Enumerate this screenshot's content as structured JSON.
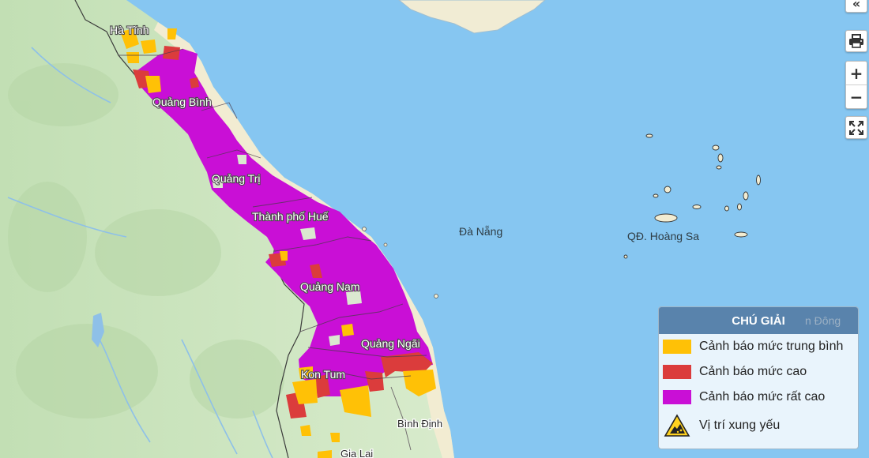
{
  "controls": {
    "collapse_glyph": "«",
    "zoom_in": "+",
    "zoom_out": "−",
    "icons": [
      "collapse-icon",
      "print-icon",
      "fullscreen-icon"
    ]
  },
  "map": {
    "province_labels": [
      "Hà Tĩnh",
      "Quảng Bình",
      "Quảng Trị",
      "Thành phố Huế",
      "Quảng Nam",
      "Quảng Ngãi",
      "Kon Tum",
      "Bình Định",
      "Gia Lai"
    ],
    "sea_labels": [
      "Đà Nẵng",
      "QĐ. Hoàng Sa"
    ],
    "partial_label": "n Đông"
  },
  "legend": {
    "title": "CHÚ GIẢI",
    "items": [
      {
        "label": "Cảnh báo mức trung bình",
        "color": "#ffc106"
      },
      {
        "label": "Cảnh báo mức cao",
        "color": "#db3c3c"
      },
      {
        "label": "Cảnh báo mức rất cao",
        "color": "#c90fd6"
      },
      {
        "label": "Vị trí xung yếu",
        "icon": "landslide-warning-icon"
      }
    ]
  },
  "colors": {
    "sea": "#86c6f1",
    "land": "#cfe4c2",
    "coast_sand": "#f2ecd2",
    "legend_header": "#5983ac",
    "legend_bg": "#e9f4fc"
  }
}
